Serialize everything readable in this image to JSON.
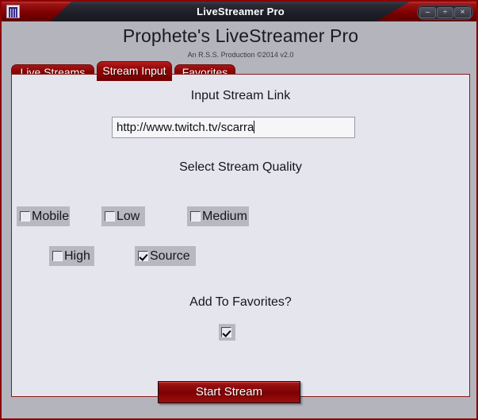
{
  "window": {
    "title": "LiveStreamer Pro",
    "icon": "app-icon",
    "controls": {
      "minimize": "–",
      "maximize": "÷",
      "close": "×"
    }
  },
  "header": {
    "title": "Prophete's LiveStreamer Pro",
    "subtitle": "An R.S.S. Production ©2014    v2.0"
  },
  "tabs": [
    {
      "label": "Live Streams",
      "active": false
    },
    {
      "label": "Stream Input",
      "active": true
    },
    {
      "label": "Favorites",
      "active": false
    }
  ],
  "main": {
    "link_section_label": "Input Stream Link",
    "link_input": {
      "value": "http://www.twitch.tv/scarra",
      "placeholder": "http://"
    },
    "quality_section_label": "Select Stream Quality",
    "quality_options": [
      {
        "label": "Mobile",
        "checked": false
      },
      {
        "label": "Low",
        "checked": false
      },
      {
        "label": "Medium",
        "checked": false
      },
      {
        "label": "High",
        "checked": false
      },
      {
        "label": "Source",
        "checked": true
      }
    ],
    "favorites_section_label": "Add To Favorites?",
    "favorites_checkbox": {
      "checked": true
    },
    "start_button_label": "Start Stream"
  },
  "colors": {
    "accent_red": "#8b0000",
    "tab_red": "#8e0606",
    "panel_bg": "#e5e5ee",
    "frame_gray": "#b4b4bd",
    "checkbox_bg": "#b8b8c2"
  }
}
